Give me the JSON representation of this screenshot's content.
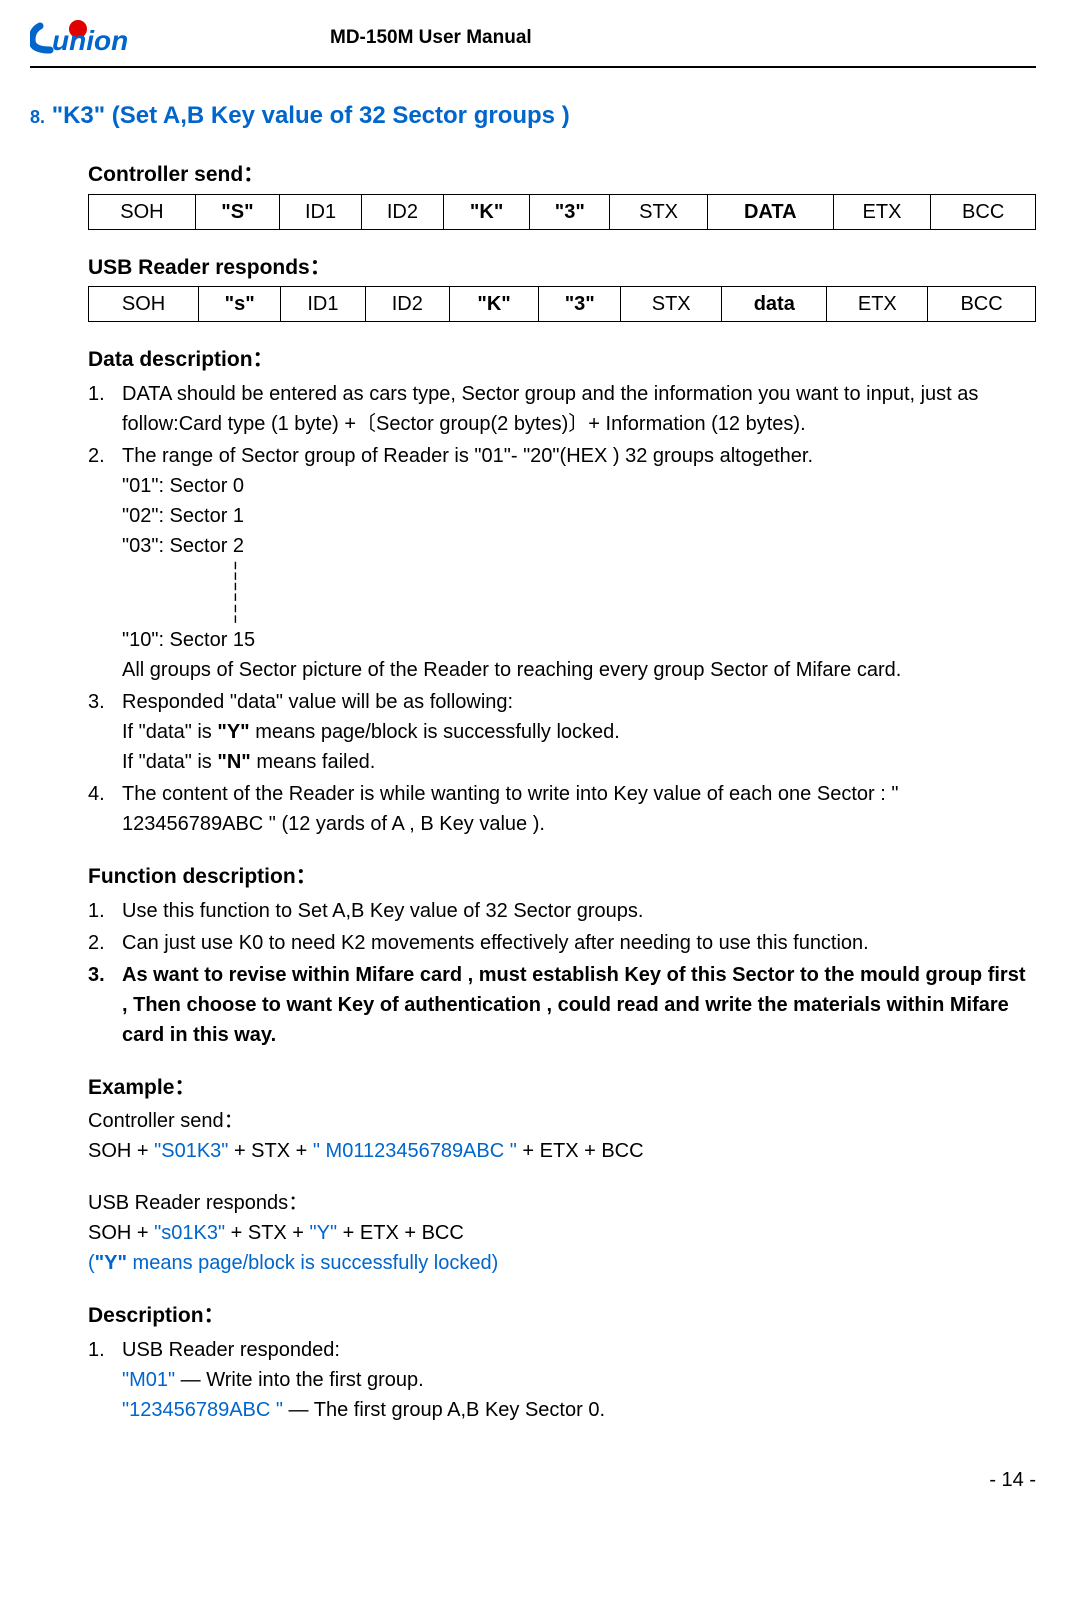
{
  "header": {
    "logo_text": "union",
    "manual_title": "MD-150M User Manual"
  },
  "section": {
    "number": "8.",
    "title": "\"K3\" (Set A,B Key value of 32 Sector groups )"
  },
  "controller_send": {
    "label": "Controller send：",
    "cells": [
      "SOH",
      "\"S\"",
      "ID1",
      "ID2",
      "\"K\"",
      "\"3\"",
      "STX",
      "DATA",
      "ETX",
      "BCC"
    ]
  },
  "usb_reader_responds": {
    "label": "USB Reader responds：",
    "cells": [
      "SOH",
      "\"s\"",
      "ID1",
      "ID2",
      "\"K\"",
      "\"3\"",
      "STX",
      "data",
      "ETX",
      "BCC"
    ]
  },
  "data_description": {
    "label": "Data description：",
    "items": [
      "DATA should be entered as cars type, Sector group and the information you want to input, just as follow:Card type (1 byte) +〔Sector group(2 bytes)〕+ Information (12 bytes).",
      "The range of Sector group of Reader is \"01\"- \"20\"(HEX ) 32 groups altogether.",
      "Responded \"data\" value will be as following:",
      "The content of the Reader is while wanting to write into Key value of each one Sector : \" 123456789ABC \" (12 yards of A , B Key value )."
    ],
    "sector_lines": [
      "\"01\":  Sector   0",
      "\"02\":  Sector   1",
      "\"03\":  Sector   2",
      "\"10\":  Sector   15"
    ],
    "sector_note": "All groups of Sector picture of the Reader to reaching every group Sector of Mifare card.",
    "resp_y_prefix": "If \"data\" is ",
    "resp_y_bold": "\"Y\"",
    "resp_y_suffix": " means page/block is successfully locked.",
    "resp_n_prefix": "If \"data\" is ",
    "resp_n_bold": "\"N\"",
    "resp_n_suffix": " means failed."
  },
  "function_description": {
    "label": "Function description：",
    "items": [
      "Use this function to Set A,B Key value of 32 Sector groups.",
      "Can just use K0 to need K2 movements effectively after needing to use this function.",
      "As want to revise within Mifare card , must establish Key of this Sector to the mould group first , Then choose to want Key of authentication , could read and write the materials within Mifare card in this way."
    ]
  },
  "example": {
    "label": "Example：",
    "ctrl_send_label": "Controller send：",
    "ctrl_send_pre": "SOH + ",
    "ctrl_send_blue1": "\"S01K3\"",
    "ctrl_send_mid": " + STX + ",
    "ctrl_send_blue2": "\" M01123456789ABC \"",
    "ctrl_send_post": " + ETX + BCC",
    "usb_resp_label": "USB Reader responds：",
    "usb_resp_pre": "SOH + ",
    "usb_resp_blue1": "\"s01K3\"",
    "usb_resp_mid": " + STX + ",
    "usb_resp_blue2": "\"Y\"",
    "usb_resp_post": " + ETX + BCC",
    "note_open": "(",
    "note_bold": "\"Y\"",
    "note_close": " means page/block is successfully locked)"
  },
  "description": {
    "label": "Description：",
    "line1": "USB Reader responded:",
    "line2_blue": "\"M01\"",
    "line2_rest": " — Write into the first group.",
    "line3_blue": "\"123456789ABC \"",
    "line3_rest": " — The first group A,B Key Sector 0."
  },
  "page_number": "- 14 -"
}
